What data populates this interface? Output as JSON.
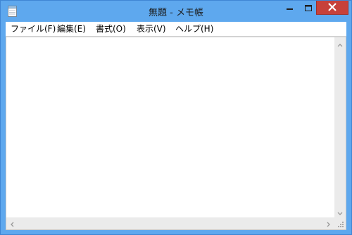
{
  "window": {
    "title": "無題 - メモ帳",
    "colors": {
      "frame": "#5ea8ee",
      "close_button": "#c7413a",
      "editor_background": "#ffffff",
      "scrollbar_track": "#ebebeb"
    }
  },
  "titlebar": {
    "icons": {
      "app": "notepad-icon",
      "minimize": "minimize-icon",
      "maximize": "maximize-icon",
      "close": "close-icon"
    }
  },
  "menubar": {
    "items": [
      {
        "label": "ファイル(F)"
      },
      {
        "label": "編集(E)"
      },
      {
        "label": "書式(O)"
      },
      {
        "label": "表示(V)"
      },
      {
        "label": "ヘルプ(H)"
      }
    ]
  },
  "editor": {
    "text": ""
  },
  "scrollbars": {
    "icons": {
      "up": "chevron-up-icon",
      "down": "chevron-down-icon",
      "left": "chevron-left-icon",
      "right": "chevron-right-icon",
      "grip": "resize-grip-icon"
    }
  }
}
